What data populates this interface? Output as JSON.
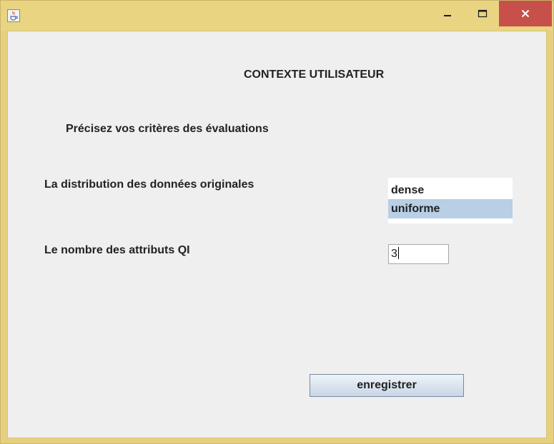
{
  "window": {
    "title": "",
    "app_icon": "java-cup-icon",
    "controls": {
      "minimize_icon": "minimize-icon",
      "maximize_icon": "maximize-icon",
      "close_icon": "close-icon",
      "close_color": "#c7504a"
    },
    "frame_color": "#e9d482"
  },
  "form": {
    "heading": "CONTEXTE UTILISATEUR",
    "subtitle": "Précisez vos critères des évaluations",
    "distribution": {
      "label": "La distribution des données originales",
      "options": [
        "dense",
        "uniforme"
      ],
      "selected": "uniforme",
      "selected_color": "#b8cfe5"
    },
    "qi_count": {
      "label": "Le nombre des attributs QI",
      "value": "3"
    },
    "save_label": "enregistrer"
  }
}
